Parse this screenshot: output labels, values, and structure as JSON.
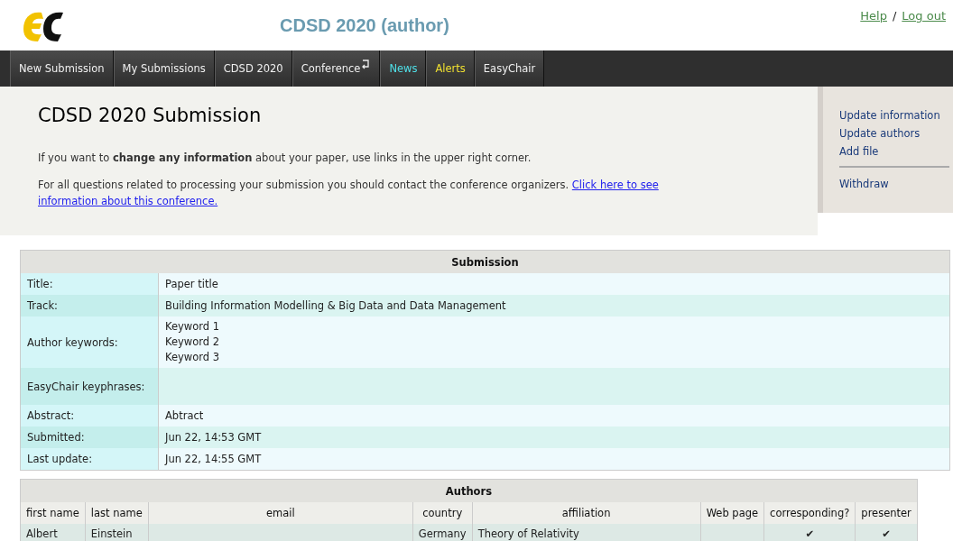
{
  "header": {
    "title": "CDSD 2020 (author)",
    "links": [
      "Help",
      "Log out"
    ],
    "separator": "/"
  },
  "nav": [
    {
      "label": "New Submission",
      "kind": "plain"
    },
    {
      "label": "My Submissions",
      "kind": "plain"
    },
    {
      "label": "CDSD 2020",
      "kind": "plain"
    },
    {
      "label": "Conference",
      "kind": "menu"
    },
    {
      "label": "News",
      "kind": "news"
    },
    {
      "label": "Alerts",
      "kind": "alerts"
    },
    {
      "label": "EasyChair",
      "kind": "plain"
    }
  ],
  "intro": {
    "heading": "CDSD 2020 Submission",
    "paragraph_1": "If you want to **change any information** about your paper, use links in the upper right corner.",
    "paragraph_2": "For all questions related to processing your submission you should contact the conference organizers.",
    "link": "Click here to see information about this conference."
  },
  "actions": {
    "items": [
      "Update information",
      "Update authors",
      "Add file"
    ],
    "after_divider": [
      "Withdraw"
    ]
  },
  "submission": {
    "heading": "Submission",
    "rows": [
      {
        "label": "Title:",
        "values": [
          "Paper title"
        ]
      },
      {
        "label": "Track:",
        "values": [
          "Building Information Modelling & Big Data and Data Management"
        ]
      },
      {
        "label": "Author keywords:",
        "values": [
          "Keyword 1",
          "Keyword 2",
          "Keyword 3"
        ]
      },
      {
        "label": "EasyChair keyphrases:",
        "values": []
      },
      {
        "label": "Abstract:",
        "values": [
          "Abtract"
        ]
      },
      {
        "label": "Submitted:",
        "values": [
          "Jun 22, 14:53 GMT"
        ]
      },
      {
        "label": "Last update:",
        "values": [
          "Jun 22, 14:55 GMT"
        ]
      }
    ]
  },
  "authors": {
    "heading": "Authors",
    "columns": [
      "first name",
      "last name",
      "email",
      "country",
      "affiliation",
      "Web page",
      "corresponding?",
      "presenter"
    ],
    "rows": [
      {
        "first_name": "Albert",
        "last_name": "Einstein",
        "country": "Germany",
        "affiliation": "Theory of Relativity",
        "corresponding": "✔",
        "presenter": "✔"
      }
    ]
  }
}
